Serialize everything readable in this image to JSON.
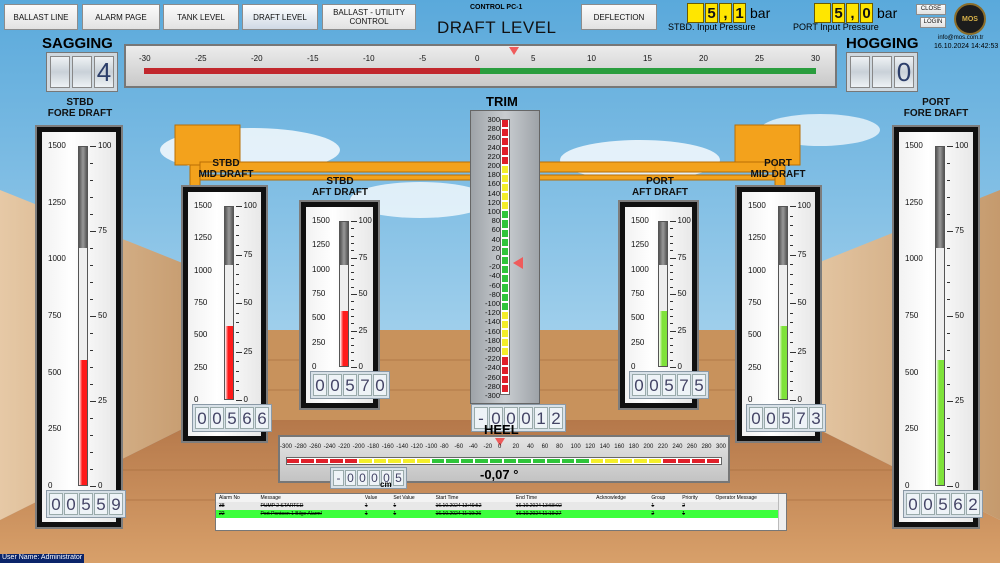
{
  "nav": {
    "buttons": [
      "BALLAST LINE",
      "ALARM PAGE",
      "TANK LEVEL",
      "DRAFT LEVEL",
      "BALLAST - UTILITY CONTROL",
      "DEFLECTION"
    ]
  },
  "header": {
    "control": "CONTROL PC-1",
    "title": "DRAFT LEVEL",
    "stbd_pressure": {
      "digits": [
        "5",
        ",",
        "1"
      ],
      "unit": "bar",
      "label": "STBD. Input Pressure"
    },
    "port_pressure": {
      "digits": [
        "5",
        ",",
        "0"
      ],
      "unit": "bar",
      "label": "PORT Input Pressure"
    },
    "close_label": "CLOSE",
    "login_label": "LOGIN",
    "logo_text": "MOS",
    "email": "info@mos.com.tr",
    "datetime": "16.10.2024 14:42:53"
  },
  "deflection": {
    "sagging_label": "SAGGING",
    "sagging_value": "4",
    "hogging_label": "HOGGING",
    "hogging_value": "0",
    "scale": [
      "-30",
      "-25",
      "-20",
      "-15",
      "-10",
      "-5",
      "0",
      "5",
      "10",
      "15",
      "20",
      "25",
      "30"
    ],
    "marker_value": 3
  },
  "gauges": {
    "stbd_fore": {
      "title": "STBD\nFORE DRAFT",
      "digits": [
        "0",
        "0",
        "5",
        "5",
        "9"
      ],
      "fill": 0.37
    },
    "stbd_mid": {
      "title": "STBD\nMID DRAFT",
      "digits": [
        "0",
        "0",
        "5",
        "6",
        "6"
      ],
      "fill": 0.38
    },
    "stbd_aft": {
      "title": "STBD\nAFT DRAFT",
      "digits": [
        "0",
        "0",
        "5",
        "7",
        "0"
      ],
      "fill": 0.38
    },
    "port_aft": {
      "title": "PORT\nAFT DRAFT",
      "digits": [
        "0",
        "0",
        "5",
        "7",
        "5"
      ],
      "fill": 0.38
    },
    "port_mid": {
      "title": "PORT\nMID DRAFT",
      "digits": [
        "0",
        "0",
        "5",
        "7",
        "3"
      ],
      "fill": 0.38
    },
    "port_fore": {
      "title": "PORT\nFORE DRAFT",
      "digits": [
        "0",
        "0",
        "5",
        "6",
        "2"
      ],
      "fill": 0.37
    },
    "left_scale": [
      "1500",
      "1250",
      "1000",
      "750",
      "500",
      "250",
      "0"
    ],
    "right_scale": [
      "100",
      "75",
      "50",
      "25",
      "0"
    ]
  },
  "trim": {
    "label": "TRIM",
    "scale": [
      "300",
      "280",
      "260",
      "240",
      "220",
      "200",
      "180",
      "160",
      "140",
      "120",
      "100",
      "80",
      "60",
      "40",
      "20",
      "0",
      "-20",
      "-40",
      "-60",
      "-80",
      "-100",
      "-120",
      "-140",
      "-160",
      "-180",
      "-200",
      "-220",
      "-240",
      "-260",
      "-280",
      "-300"
    ],
    "digits": [
      "-",
      "0",
      "0",
      "0",
      "1",
      "2"
    ],
    "marker_value": -12
  },
  "heel": {
    "label": "HEEL",
    "scale": [
      "-300",
      "-280",
      "-260",
      "-240",
      "-220",
      "-200",
      "-180",
      "-160",
      "-140",
      "-120",
      "-100",
      "-80",
      "-60",
      "-40",
      "-20",
      "0",
      "20",
      "40",
      "60",
      "80",
      "100",
      "120",
      "140",
      "160",
      "180",
      "200",
      "220",
      "240",
      "260",
      "280",
      "300"
    ],
    "digits": [
      "-",
      "0",
      "0",
      "0",
      "0",
      "5"
    ],
    "unit": "cm",
    "angle": "-0,07 °",
    "marker_value": -5
  },
  "alarms": {
    "columns": [
      "Alarm No",
      "Message",
      "Value",
      "Set Value",
      "Start Time",
      "End Time",
      "Acknowledge",
      "Group",
      "Priority",
      "Operator Message"
    ],
    "rows": [
      [
        "38",
        "PUMP 2 STARTED",
        "1",
        "1",
        "16.10.2024 13:49:52",
        "16.10.2024 13:58:02",
        "",
        "1",
        "2",
        ""
      ],
      [
        "22",
        "Port Pontoon 1 Bilge Alarm!",
        "1",
        "1",
        "16.10.2024 11:19:26",
        "16.10.2024 11:19:27",
        "",
        "2",
        "1",
        ""
      ]
    ]
  },
  "status": {
    "user": "User Name: Administrator"
  },
  "colors": {
    "red": "#e0202a",
    "green": "#2fc53a",
    "yellow": "#f4ee2a",
    "gauge_fill_red": "#ff1b1b",
    "gauge_fill_green": "#7fe23a",
    "crane": "#f3a21c",
    "selected_row": "#3cff3c"
  }
}
